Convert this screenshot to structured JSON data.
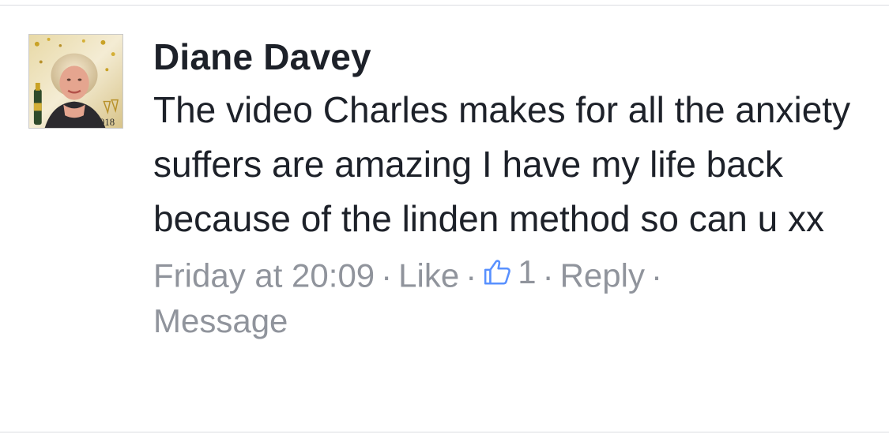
{
  "comment": {
    "author": "Diane Davey",
    "text": "The video Charles makes for all the anxiety suffers are amazing I have my life back because of the linden method so can u xx",
    "timestamp": "Friday at 20:09",
    "like_label": "Like",
    "like_count": "1",
    "reply_label": "Reply",
    "message_label": "Message",
    "separator": "·"
  },
  "avatar": {
    "badge_text": "2018"
  },
  "colors": {
    "author_text": "#1d2129",
    "meta_text": "#90949c",
    "like_icon": "#5890ff"
  },
  "icons": {
    "like_icon": "thumbs-up-icon"
  }
}
